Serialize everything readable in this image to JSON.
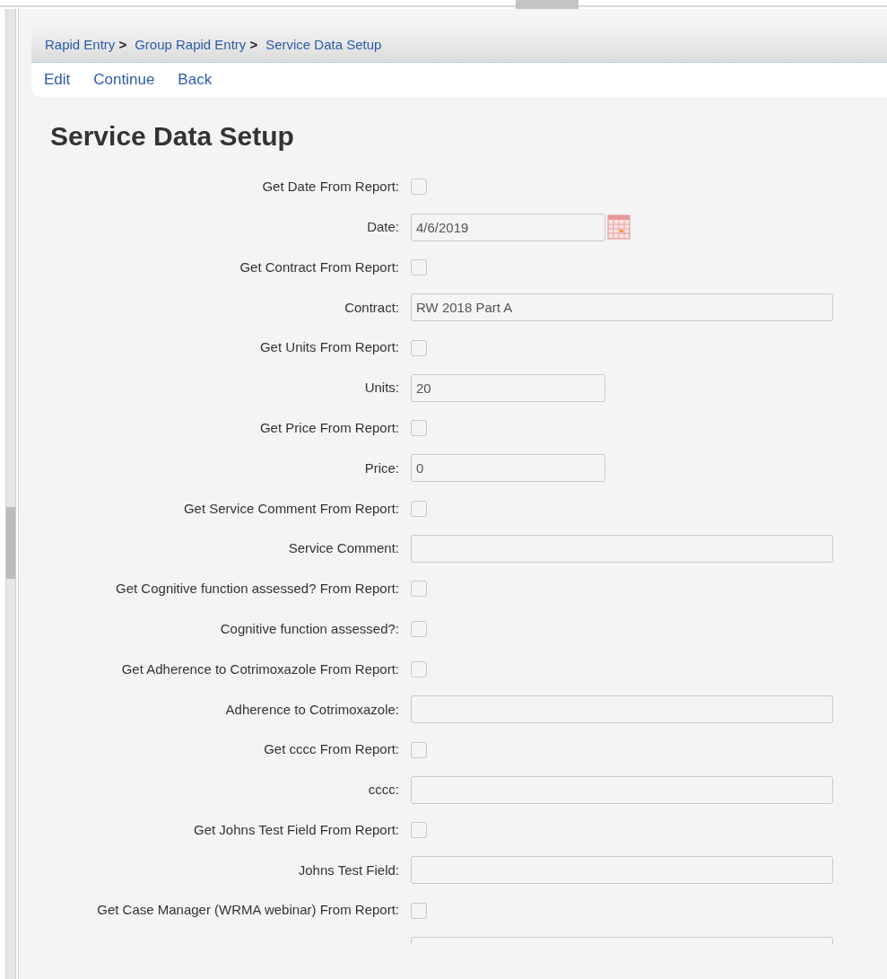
{
  "breadcrumb": [
    {
      "label": "Rapid Entry",
      "separator": ">"
    },
    {
      "label": "Group Rapid Entry",
      "separator": ">"
    },
    {
      "label": "Service Data Setup"
    }
  ],
  "menu": [
    "Edit",
    "Continue",
    "Back"
  ],
  "title": "Service Data Setup",
  "fields": [
    {
      "kind": "checkbox",
      "label": "Get Date From Report:",
      "checked": false
    },
    {
      "kind": "date",
      "label": "Date:",
      "value": "4/6/2019"
    },
    {
      "kind": "checkbox",
      "label": "Get Contract From Report:",
      "checked": false
    },
    {
      "kind": "wide_text",
      "label": "Contract:",
      "value": "RW 2018 Part A"
    },
    {
      "kind": "checkbox",
      "label": "Get Units From Report:",
      "checked": false
    },
    {
      "kind": "text",
      "label": "Units:",
      "value": "20"
    },
    {
      "kind": "checkbox",
      "label": "Get Price From Report:",
      "checked": false
    },
    {
      "kind": "text",
      "label": "Price:",
      "value": "0"
    },
    {
      "kind": "checkbox",
      "label": "Get Service Comment From Report:",
      "checked": false
    },
    {
      "kind": "wide_text",
      "label": "Service Comment:"
    },
    {
      "kind": "checkbox",
      "label": "Get Cognitive function assessed? From Report:",
      "checked": false
    },
    {
      "kind": "checkbox",
      "label": "Cognitive function assessed?:",
      "checked": false
    },
    {
      "kind": "checkbox",
      "label": "Get Adherence to Cotrimoxazole From Report:",
      "checked": false
    },
    {
      "kind": "wide_text",
      "label": "Adherence to Cotrimoxazole:"
    },
    {
      "kind": "checkbox",
      "label": "Get cccc From Report:",
      "checked": false
    },
    {
      "kind": "wide_text",
      "label": "cccc:"
    },
    {
      "kind": "checkbox",
      "label": "Get Johns Test Field From Report:",
      "checked": false
    },
    {
      "kind": "wide_text",
      "label": "Johns Test Field:"
    },
    {
      "kind": "checkbox",
      "label": "Get Case Manager (WRMA webinar) From Report:",
      "checked": false
    },
    {
      "kind": "wide_text"
    }
  ]
}
